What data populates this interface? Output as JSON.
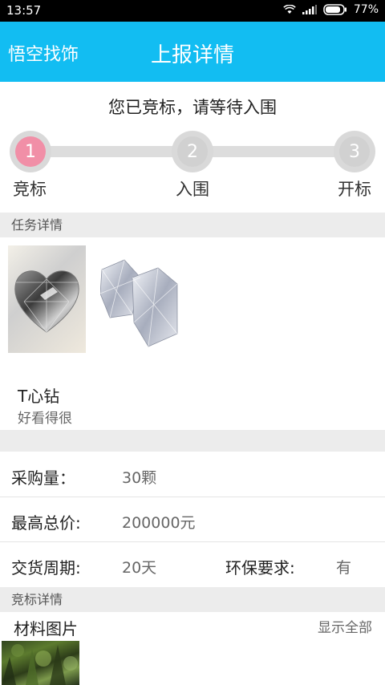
{
  "status_bar": {
    "time": "13:57",
    "battery": "77%",
    "icons": [
      "wifi-icon",
      "signal-icon",
      "battery-icon"
    ]
  },
  "app_bar": {
    "left_label": "悟空找饰",
    "title": "上报详情",
    "color": "#12bdf2"
  },
  "bid_status": "您已竞标，请等待入围",
  "progress": {
    "active_color": "#f18fa7",
    "steps": [
      {
        "number": "1",
        "label": "竞标",
        "active": true
      },
      {
        "number": "2",
        "label": "入围",
        "active": false
      },
      {
        "number": "3",
        "label": "开标",
        "active": false
      }
    ]
  },
  "task_section": {
    "header": "任务详情",
    "images": [
      "heart-diamond-image",
      "diamonds-image"
    ],
    "product_name": "T心钻",
    "product_desc": "好看得很"
  },
  "details": {
    "quantity_label": "采购量：",
    "quantity_value": "30颗",
    "max_price_label": "最高总价:",
    "max_price_value": "200000元",
    "delivery_label": "交货周期:",
    "delivery_value": "20天",
    "eco_label": "环保要求:",
    "eco_value": "有"
  },
  "bid_section": {
    "header": "竞标详情",
    "materials_label": "材料图片",
    "show_all": "显示全部"
  }
}
